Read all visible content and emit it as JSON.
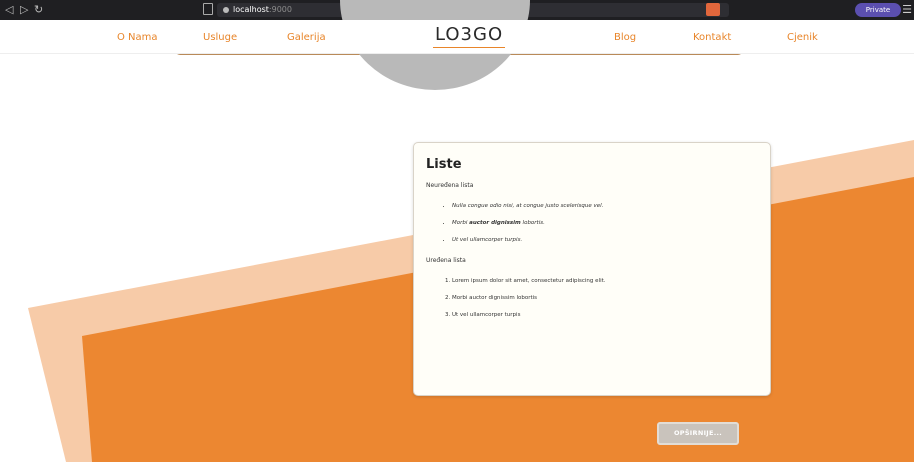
{
  "browser": {
    "url_host": "localhost",
    "url_port": ":9000",
    "private_label": "Private"
  },
  "nav": {
    "items": [
      "O Nama",
      "Usluge",
      "Galerija",
      "Blog",
      "Kontakt",
      "Cjenik"
    ],
    "logo": "LO3GO"
  },
  "colors": {
    "accent": "#e8852a",
    "band": "#f7cba8"
  },
  "card": {
    "title": "Liste",
    "unordered_label": "Neuređena lista",
    "unordered_items": [
      {
        "before": "Nulla congue odio nisi, at congue justo scelerisque vel.",
        "bold": "",
        "after": ""
      },
      {
        "before": "Morbi ",
        "bold": "auctor dignissim",
        "after": " lobortis."
      },
      {
        "before": "Ut vel ullamcorper turpis.",
        "bold": "",
        "after": ""
      }
    ],
    "ordered_label": "Uređena lista",
    "ordered_items": [
      "Lorem ipsum dolor sit amet, consectetur adipiscing elit.",
      "Morbi auctor dignissim lobortis",
      "Ut vel ullamcorper turpis"
    ]
  },
  "more_button": "OPŠIRNIJE..."
}
